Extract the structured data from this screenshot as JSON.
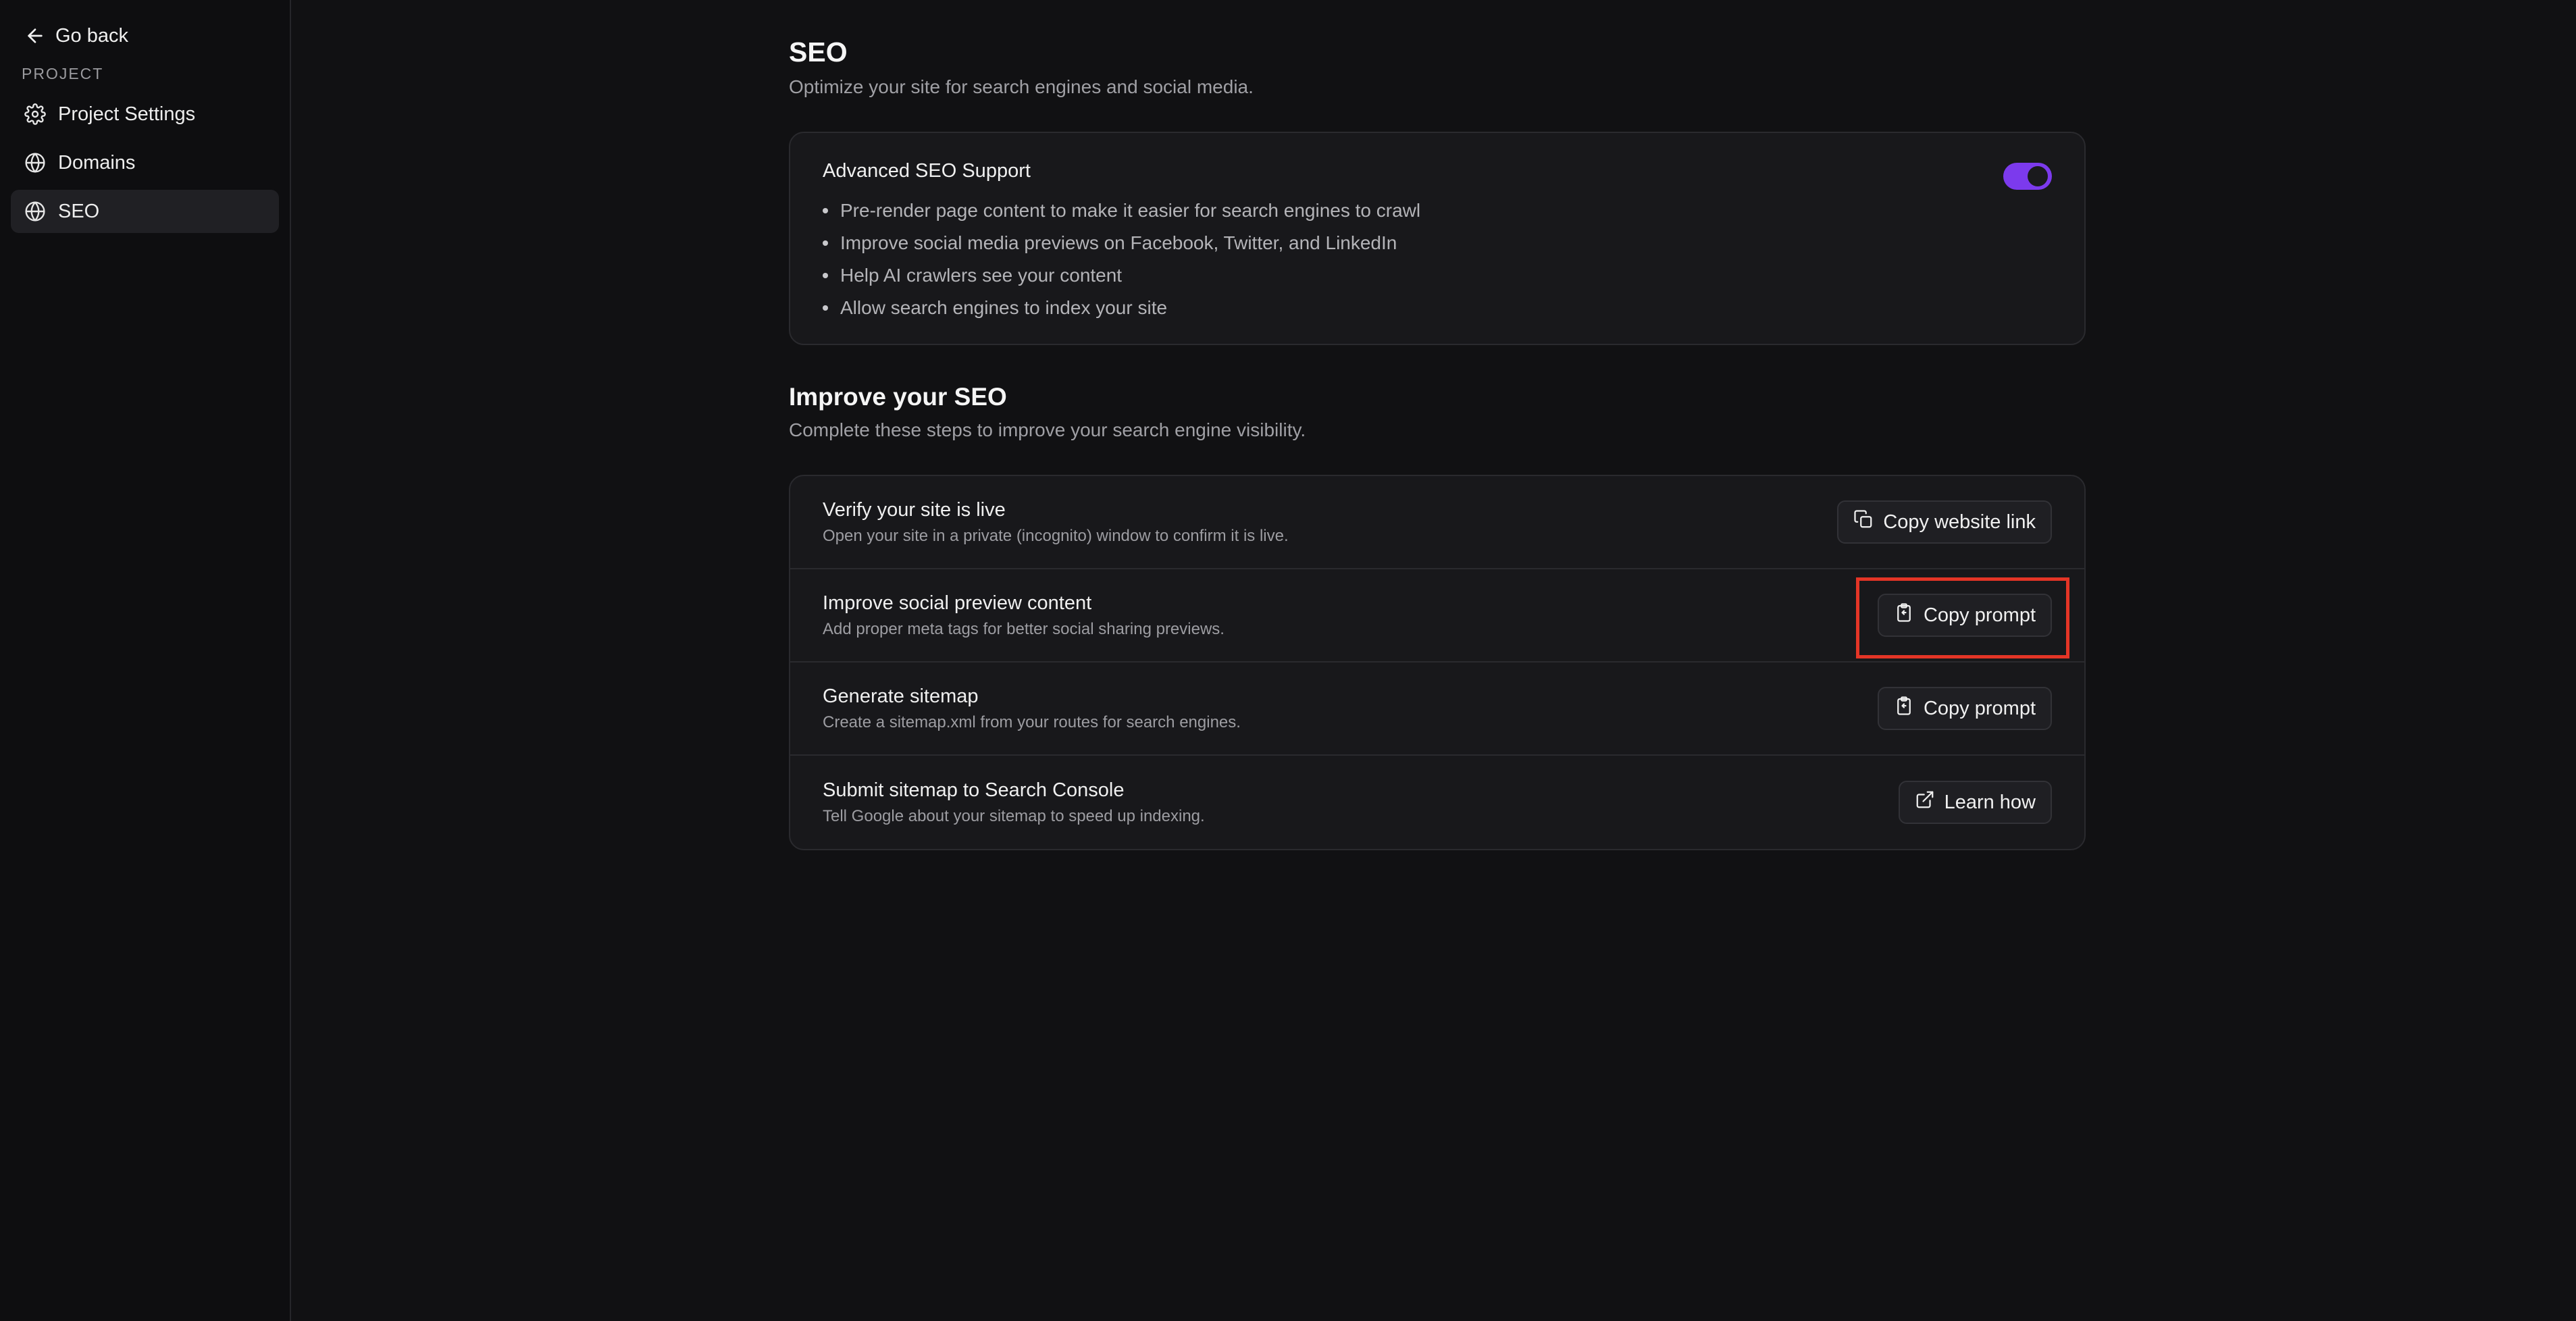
{
  "sidebar": {
    "go_back": "Go back",
    "section_label": "PROJECT",
    "items": [
      {
        "label": "Project Settings",
        "icon": "gear-icon",
        "active": false
      },
      {
        "label": "Domains",
        "icon": "globe-icon",
        "active": false
      },
      {
        "label": "SEO",
        "icon": "globe-icon",
        "active": true
      }
    ]
  },
  "header": {
    "title": "SEO",
    "subtitle": "Optimize your site for search engines and social media."
  },
  "advanced_seo": {
    "title": "Advanced SEO Support",
    "enabled": true,
    "bullets": [
      "Pre-render page content to make it easier for search engines to crawl",
      "Improve social media previews on Facebook, Twitter, and LinkedIn",
      "Help AI crawlers see your content",
      "Allow search engines to index your site"
    ]
  },
  "improve": {
    "title": "Improve your SEO",
    "subtitle": "Complete these steps to improve your search engine visibility.",
    "steps": [
      {
        "title": "Verify your site is live",
        "desc": "Open your site in a private (incognito) window to confirm it is live.",
        "button": "Copy website link",
        "icon": "copy-icon"
      },
      {
        "title": "Improve social preview content",
        "desc": "Add proper meta tags for better social sharing previews.",
        "button": "Copy prompt",
        "icon": "clipboard-icon"
      },
      {
        "title": "Generate sitemap",
        "desc": "Create a sitemap.xml from your routes for search engines.",
        "button": "Copy prompt",
        "icon": "clipboard-icon"
      },
      {
        "title": "Submit sitemap to Search Console",
        "desc": "Tell Google about your sitemap to speed up indexing.",
        "button": "Learn how",
        "icon": "external-link-icon"
      }
    ]
  },
  "colors": {
    "accent": "#7c3aed",
    "highlight": "#e43526",
    "background": "#111113"
  }
}
